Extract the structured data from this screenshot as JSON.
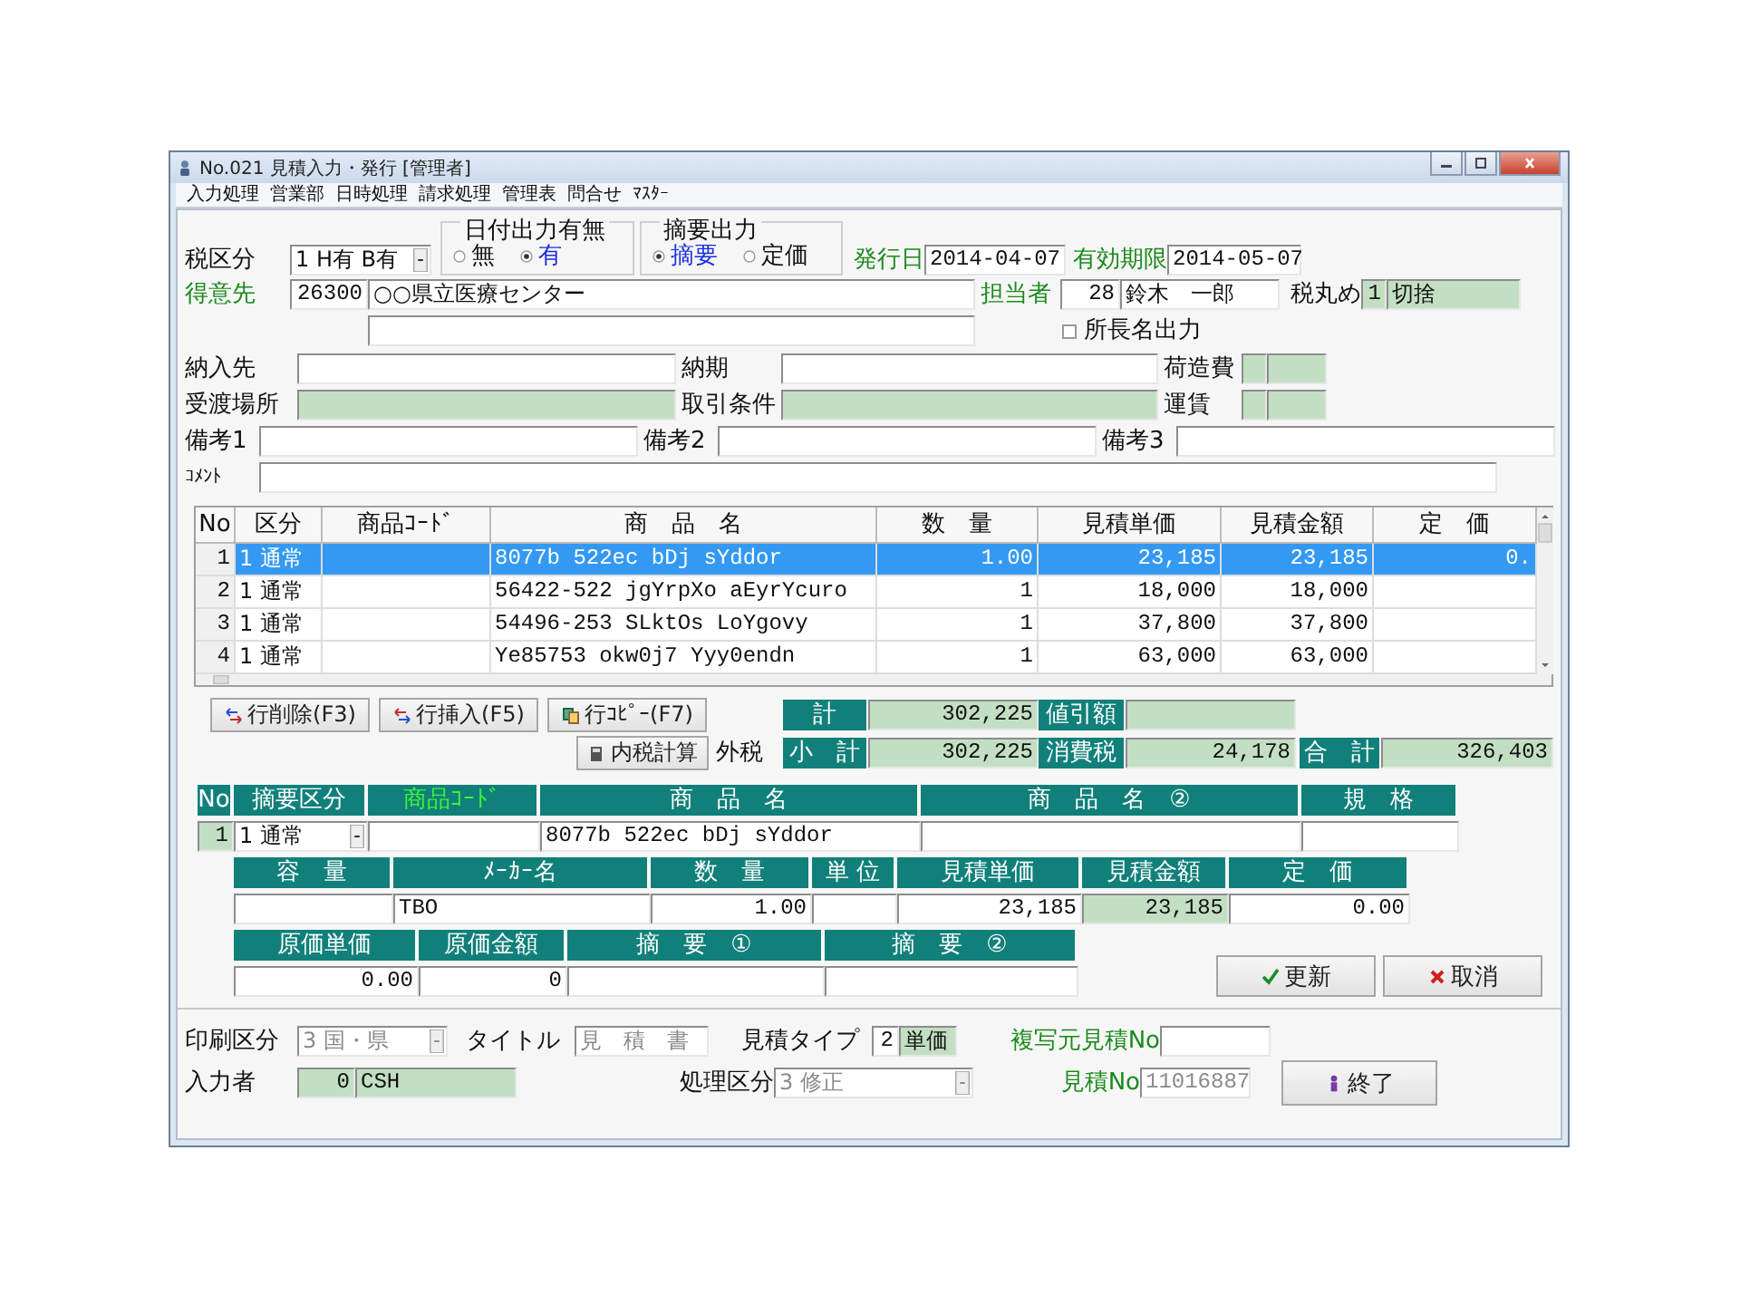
{
  "window": {
    "title": "No.021 見積入力・発行 [管理者]"
  },
  "menu": [
    "入力処理",
    "営業部",
    "日時処理",
    "請求処理",
    "管理表",
    "問合せ",
    "ﾏｽﾀｰ"
  ],
  "header": {
    "tax_class": {
      "label": "税区分",
      "value": "1 H有 B有"
    },
    "date_output": {
      "label": "日付出力有無",
      "options": [
        {
          "label": "無",
          "selected": false
        },
        {
          "label": "有",
          "selected": true
        }
      ]
    },
    "summary_output": {
      "label": "摘要出力",
      "options": [
        {
          "label": "摘要",
          "selected": true
        },
        {
          "label": "定価",
          "selected": false
        }
      ]
    },
    "issue_date": {
      "label": "発行日",
      "value": "2014-04-07"
    },
    "valid_until": {
      "label": "有効期限",
      "value": "2014-05-07"
    },
    "customer": {
      "label": "得意先",
      "code": "26300",
      "name": "○○県立医療センター"
    },
    "staff": {
      "label": "担当者",
      "code": "28",
      "name": "鈴木　一郎"
    },
    "tax_rounding": {
      "label": "税丸め",
      "code": "1",
      "name": "切捨"
    },
    "director_name_output": {
      "label": "所長名出力",
      "checked": false
    },
    "delivery_to": {
      "label": "納入先"
    },
    "delivery_date": {
      "label": "納期"
    },
    "packing_fee": {
      "label": "荷造費"
    },
    "handover_place": {
      "label": "受渡場所"
    },
    "trade_terms": {
      "label": "取引条件"
    },
    "freight": {
      "label": "運賃"
    },
    "notes": [
      {
        "label": "備考1"
      },
      {
        "label": "備考2"
      },
      {
        "label": "備考3"
      }
    ],
    "comment": {
      "label": "ｺﾒﾝﾄ"
    }
  },
  "items": {
    "columns": [
      "No",
      "区分",
      "商品ｺｰﾄﾞ",
      "商　品　名",
      "数　量",
      "見積単価",
      "見積金額",
      "定　価"
    ],
    "rows": [
      {
        "no": "1",
        "category": "1 通常",
        "name": "8077b 522ec bDj sYddor",
        "quantity": "1.00",
        "unit_price": "23,185",
        "amount": "23,185",
        "list_price": "0.",
        "selected": true
      },
      {
        "no": "2",
        "category": "1 通常",
        "name": "56422-522 jgYrpXo aEyrYcuro",
        "quantity": "1",
        "unit_price": "18,000",
        "amount": "18,000",
        "selected": false
      },
      {
        "no": "3",
        "category": "1 通常",
        "name": "54496-253 SLktOs LoYgovy",
        "quantity": "1",
        "unit_price": "37,800",
        "amount": "37,800",
        "selected": false
      },
      {
        "no": "4",
        "category": "1 通常",
        "name": "Ye85753 okw0j7 Yyy0endn",
        "quantity": "1",
        "unit_price": "63,000",
        "amount": "63,000",
        "selected": false
      }
    ]
  },
  "row_buttons": [
    {
      "label": "行削除(F3)",
      "kind": "delete"
    },
    {
      "label": "行挿入(F5)",
      "kind": "insert"
    },
    {
      "label": "行ｺﾋﾟｰ(F7)",
      "kind": "copy"
    }
  ],
  "inner_tax_button": {
    "label": "内税計算"
  },
  "tax_mode": "外税",
  "totals": {
    "total": {
      "label": "計",
      "value": "302,225"
    },
    "discount": {
      "label": "値引額"
    },
    "subtotal": {
      "label": "小　計",
      "value": "302,225"
    },
    "tax": {
      "label": "消費税",
      "value": "24,178"
    },
    "grand_total": {
      "label": "合　計",
      "value": "326,403"
    }
  },
  "detail": {
    "groups": [
      [
        {
          "label": "No",
          "value": "1",
          "kind": "index",
          "highlight": false
        },
        {
          "label": "摘要区分",
          "value": "1 通常",
          "kind": "dropdown",
          "highlight": false
        },
        {
          "label": "商品ｺｰﾄﾞ",
          "kind": "text",
          "highlight": true
        },
        {
          "label": "商　品　名",
          "value": "8077b 522ec bDj sYddor",
          "kind": "text",
          "highlight": false
        },
        {
          "label": "商　品　名　②",
          "kind": "text",
          "highlight": false
        },
        {
          "label": "規　格",
          "kind": "text",
          "highlight": false
        }
      ],
      [
        {
          "label": "容　量",
          "kind": "text"
        },
        {
          "label": "ﾒｰｶｰ名",
          "value": "TBO",
          "kind": "text"
        },
        {
          "label": "数　量",
          "value": "1.00",
          "kind": "number"
        },
        {
          "label": "単 位",
          "kind": "text"
        },
        {
          "label": "見積単価",
          "value": "23,185",
          "kind": "number"
        },
        {
          "label": "見積金額",
          "value": "23,185",
          "kind": "readonly"
        },
        {
          "label": "定　価",
          "value": "0.00",
          "kind": "number"
        }
      ],
      [
        {
          "label": "原価単価",
          "value": "0.00",
          "kind": "number"
        },
        {
          "label": "原価金額",
          "value": "0",
          "kind": "number"
        },
        {
          "label": "摘　要　①",
          "kind": "text"
        },
        {
          "label": "摘　要　②",
          "kind": "text"
        }
      ]
    ]
  },
  "actions": [
    {
      "label": "更新",
      "kind": "update"
    },
    {
      "label": "取消",
      "kind": "cancel"
    }
  ],
  "footer": {
    "print_class": {
      "label": "印刷区分",
      "value": "3 国・県",
      "disabled": true
    },
    "title": {
      "label": "タイトル",
      "value": "見　積　書",
      "disabled": true
    },
    "estimate_type": {
      "label": "見積タイプ",
      "code": "2",
      "name": "単価"
    },
    "copy_source_no": {
      "label": "複写元見積No"
    },
    "entered_by": {
      "label": "入力者",
      "code": "0",
      "name": "CSH"
    },
    "process_class": {
      "label": "処理区分",
      "value": "3 修正",
      "disabled": true
    },
    "estimate_no": {
      "label": "見積No",
      "value": "11016887",
      "disabled": true
    },
    "exit_button": {
      "label": "終了"
    }
  }
}
